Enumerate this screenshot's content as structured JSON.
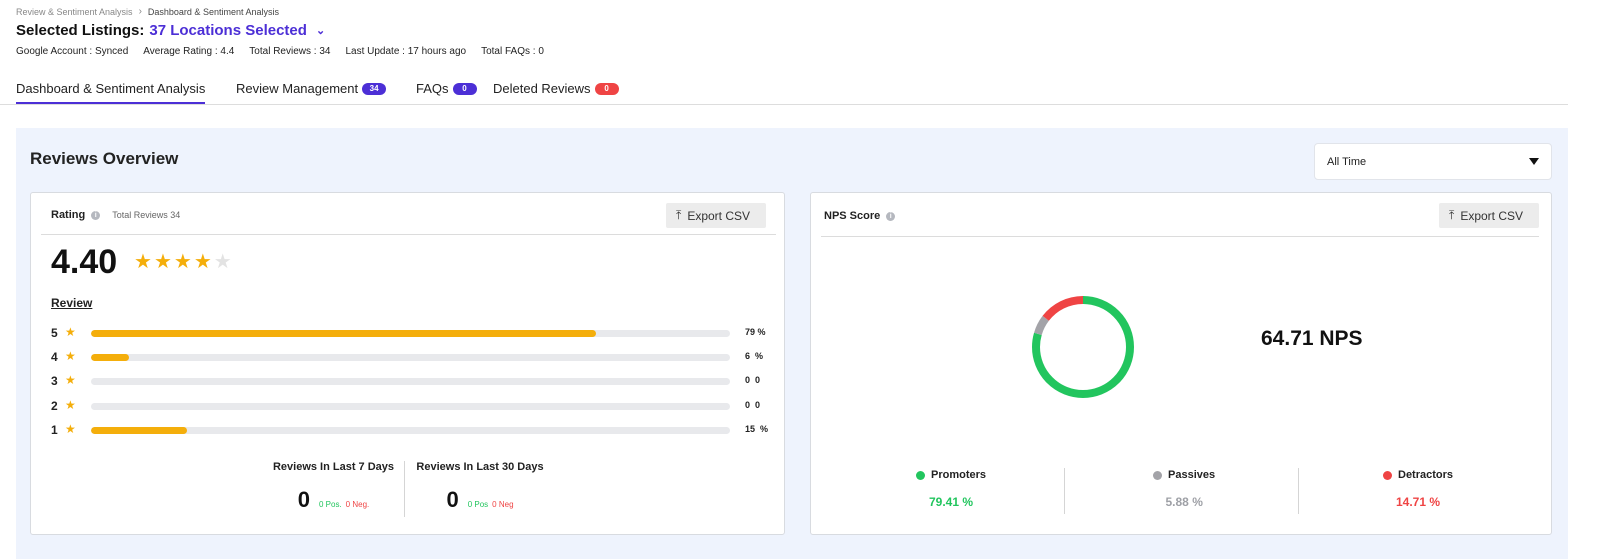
{
  "breadcrumb": {
    "parent": "Review & Sentiment Analysis",
    "current": "Dashboard & Sentiment Analysis"
  },
  "header": {
    "title_prefix": "Selected Listings:",
    "title_value": "37 Locations Selected"
  },
  "meta": {
    "google_account": "Google Account : Synced",
    "average_rating": "Average Rating : 4.4",
    "total_reviews": "Total Reviews : 34",
    "last_update": "Last Update : 17 hours ago",
    "total_faqs": "Total FAQs : 0"
  },
  "tabs": {
    "dashboard": "Dashboard & Sentiment Analysis",
    "review_management": "Review Management",
    "review_management_badge": "34",
    "faqs": "FAQs",
    "faqs_badge": "0",
    "deleted_reviews": "Deleted Reviews",
    "deleted_reviews_badge": "0"
  },
  "overview": {
    "title": "Reviews Overview",
    "filter_value": "All Time"
  },
  "rating_card": {
    "title": "Rating",
    "total_reviews_label": "Total Reviews 34",
    "export_label": "Export CSV",
    "average": "4.40",
    "stars_filled": 4,
    "stars_total": 5,
    "review_label": "Review",
    "bars": [
      {
        "star": "5",
        "percent": 79,
        "label": "79 %"
      },
      {
        "star": "4",
        "percent": 6,
        "label": "6  %"
      },
      {
        "star": "3",
        "percent": 0,
        "label": "0  0"
      },
      {
        "star": "2",
        "percent": 0,
        "label": "0  0"
      },
      {
        "star": "1",
        "percent": 15,
        "label": "15  %"
      }
    ],
    "last7": {
      "title": "Reviews In Last 7 Days",
      "count": "0",
      "pos": "0 Pos.",
      "neg": "0 Neg."
    },
    "last30": {
      "title": "Reviews In Last 30 Days",
      "count": "0",
      "pos": "0 Pos",
      "neg": "0 Neg"
    }
  },
  "nps_card": {
    "title": "NPS Score",
    "export_label": "Export CSV",
    "score_text": "64.71 NPS",
    "segments": [
      {
        "name": "Promoters",
        "value": 79.41,
        "label": "79.41 %",
        "color": "#22c55e"
      },
      {
        "name": "Passives",
        "value": 5.88,
        "label": "5.88 %",
        "color": "#a3a3a8"
      },
      {
        "name": "Detractors",
        "value": 14.71,
        "label": "14.71 %",
        "color": "#ef4444"
      }
    ]
  },
  "colors": {
    "accent": "#4c2fd6",
    "star": "#f4ae0b",
    "track": "#e8e9ec",
    "overview_bg": "#eef3fd"
  }
}
